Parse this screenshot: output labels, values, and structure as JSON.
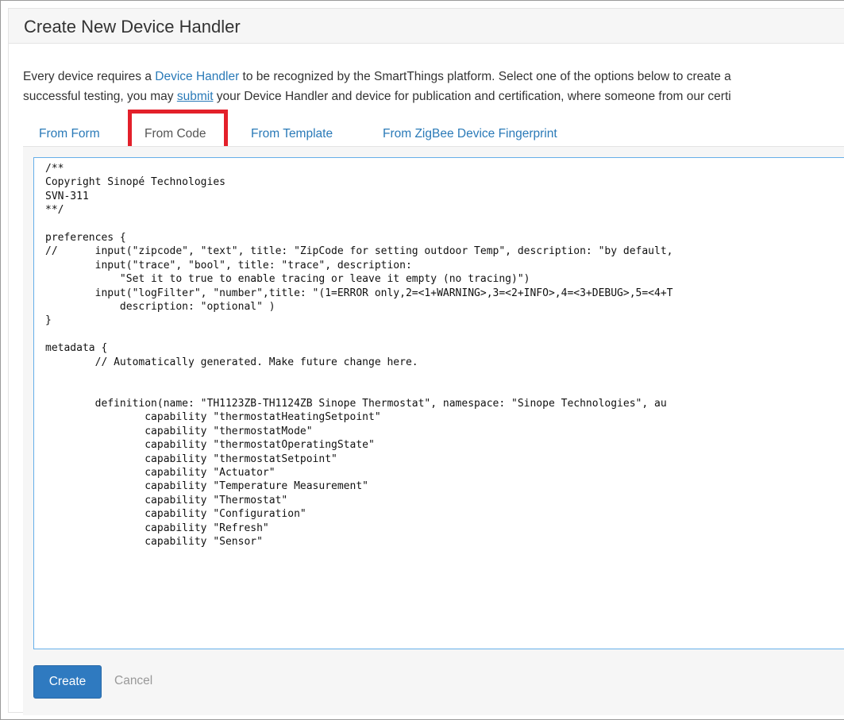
{
  "panel": {
    "title": "Create New Device Handler"
  },
  "intro": {
    "line1_prefix": "Every device requires a ",
    "line1_link": "Device Handler",
    "line1_suffix": " to be recognized by the SmartThings platform. Select one of the options below to create a",
    "line2_prefix": "successful testing, you may ",
    "line2_link": "submit",
    "line2_suffix": " your Device Handler and device for publication and certification, where someone from our certi"
  },
  "tabs": [
    {
      "label": "From Form",
      "active": false
    },
    {
      "label": "From Code",
      "active": true
    },
    {
      "label": "From Template",
      "active": false
    },
    {
      "label": "From ZigBee Device Fingerprint",
      "active": false
    }
  ],
  "editor": {
    "code": "/**\nCopyright Sinopé Technologies\nSVN-311\n**/\n\npreferences {\n//      input(\"zipcode\", \"text\", title: \"ZipCode for setting outdoor Temp\", description: \"by default,\n        input(\"trace\", \"bool\", title: \"trace\", description:\n            \"Set it to true to enable tracing or leave it empty (no tracing)\")\n        input(\"logFilter\", \"number\",title: \"(1=ERROR only,2=<1+WARNING>,3=<2+INFO>,4=<3+DEBUG>,5=<4+T\n            description: \"optional\" )\n}\n\nmetadata {\n        // Automatically generated. Make future change here.\n\n\n        definition(name: \"TH1123ZB-TH1124ZB Sinope Thermostat\", namespace: \"Sinope Technologies\", au\n                capability \"thermostatHeatingSetpoint\"\n                capability \"thermostatMode\"\n                capability \"thermostatOperatingState\"\n                capability \"thermostatSetpoint\"\n                capability \"Actuator\"\n                capability \"Temperature Measurement\"\n                capability \"Thermostat\"\n                capability \"Configuration\"\n                capability \"Refresh\"\n                capability \"Sensor\""
  },
  "actions": {
    "create_label": "Create",
    "cancel_label": "Cancel"
  },
  "colors": {
    "link": "#2a7ab8",
    "primary_button": "#2f7ac0",
    "highlight": "#e3202a",
    "editor_focus_border": "#66afe9"
  }
}
